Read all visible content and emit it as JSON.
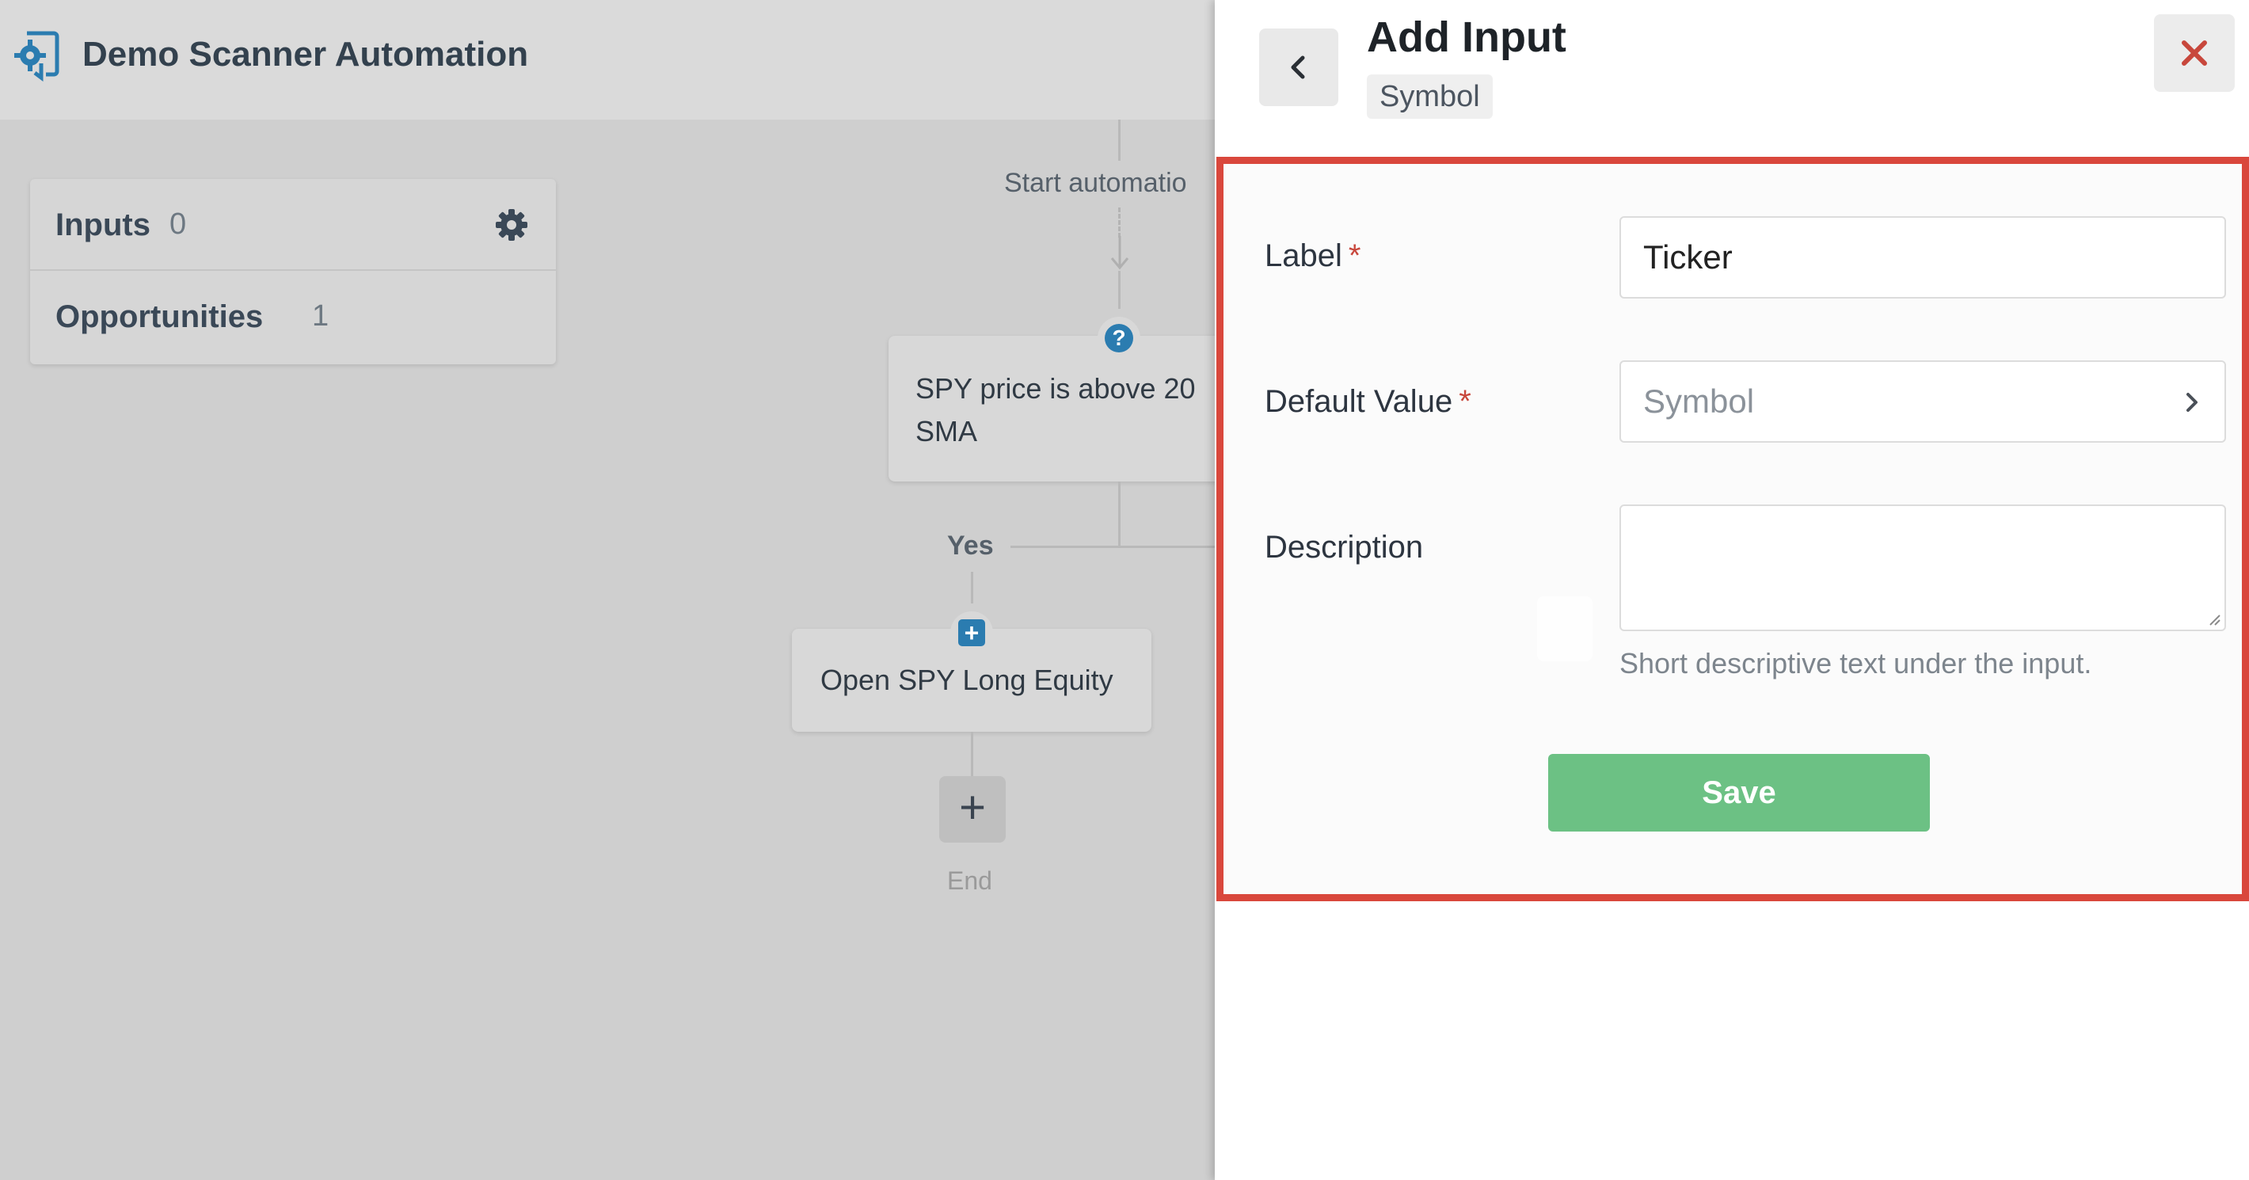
{
  "app": {
    "title": "Demo Scanner Automation",
    "logo_icon": "gear-document-icon"
  },
  "sidebar": {
    "items": [
      {
        "label": "Inputs",
        "count": "0",
        "icon": "gear-icon"
      },
      {
        "label": "Opportunities",
        "count": "1"
      }
    ]
  },
  "flow": {
    "start_label": "Start automatio",
    "condition_node": {
      "icon": "question-icon",
      "line1": "SPY price is above 20",
      "line2": "SMA"
    },
    "branch_label": "Yes",
    "action_node": {
      "icon": "plus-square-icon",
      "label": "Open SPY Long Equity"
    },
    "add_step_symbol": "+",
    "end_label": "End"
  },
  "panel": {
    "title": "Add Input",
    "type_chip": "Symbol",
    "back_icon": "chevron-left-icon",
    "close_icon": "close-icon",
    "fields": {
      "label": {
        "label": "Label",
        "required_mark": "*",
        "value": "Ticker"
      },
      "default_value": {
        "label": "Default Value",
        "required_mark": "*",
        "placeholder": "Symbol"
      },
      "description": {
        "label": "Description",
        "value": "",
        "help": "Short descriptive text under the input."
      }
    },
    "save_label": "Save"
  },
  "colors": {
    "accent_blue": "#2b7cb0",
    "save_green": "#6cc184",
    "highlight_red": "#d9473c",
    "close_red": "#c8473c"
  }
}
